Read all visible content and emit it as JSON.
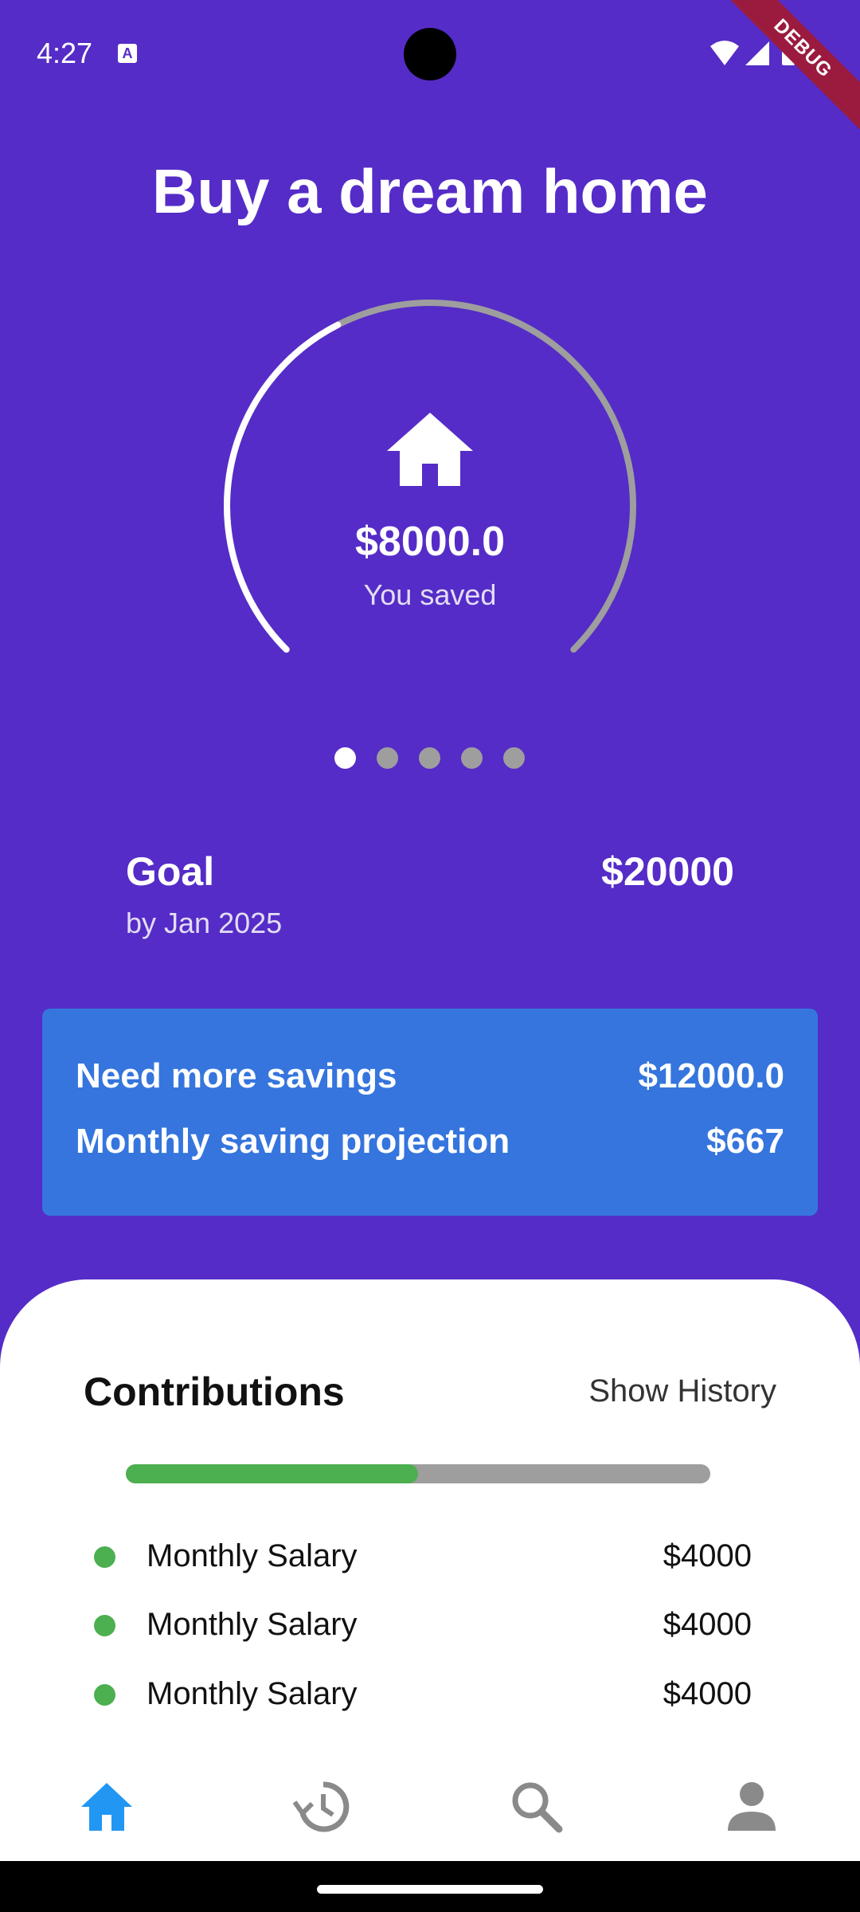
{
  "status_bar": {
    "time": "4:27",
    "debug_label": "DEBUG"
  },
  "header": {
    "title": "Buy a dream home"
  },
  "savings": {
    "amount": "$8000.0",
    "label": "You saved",
    "progress_fraction": 0.4
  },
  "pager": {
    "count": 5,
    "active_index": 0
  },
  "goal": {
    "label": "Goal",
    "date": "by Jan 2025",
    "amount": "$20000"
  },
  "summary": {
    "need_more_label": "Need more savings",
    "need_more_value": "$12000.0",
    "projection_label": "Monthly saving projection",
    "projection_value": "$667"
  },
  "contributions": {
    "title": "Contributions",
    "show_history_label": "Show History",
    "progress_fraction": 0.5,
    "items": [
      {
        "label": "Monthly Salary",
        "amount": "$4000"
      },
      {
        "label": "Monthly Salary",
        "amount": "$4000"
      },
      {
        "label": "Monthly Salary",
        "amount": "$4000"
      }
    ]
  },
  "bottom_nav": {
    "items": [
      {
        "icon": "home-icon",
        "active": true
      },
      {
        "icon": "history-icon",
        "active": false
      },
      {
        "icon": "search-icon",
        "active": false
      },
      {
        "icon": "person-icon",
        "active": false
      }
    ]
  },
  "colors": {
    "background": "#552CC7",
    "card": "#3575DD",
    "accent_green": "#4CAF50",
    "nav_active": "#2196F3",
    "nav_inactive": "#8A8A8A"
  }
}
